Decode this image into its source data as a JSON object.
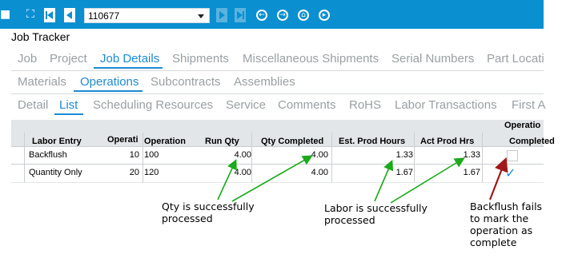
{
  "toolbar": {
    "search_icon": "binoculars-icon",
    "job_number": "110677",
    "colors": {
      "bar": "#0a8fd1",
      "accent": "#1d8ad4"
    }
  },
  "app": {
    "title": "Job Tracker"
  },
  "tabs_level1": [
    "Job",
    "Project",
    "Job Details",
    "Shipments",
    "Miscellaneous Shipments",
    "Serial Numbers",
    "Part Locati"
  ],
  "tabs_level2": [
    "Materials",
    "Operations",
    "Subcontracts",
    "Assemblies"
  ],
  "tabs_level3": [
    "Detail",
    "List",
    "Scheduling Resources",
    "Service",
    "Comments",
    "RoHS",
    "Labor Transactions",
    "First A"
  ],
  "grid": {
    "group_header": "Operatio",
    "columns": [
      "Labor Entry",
      "Operati",
      "Operation",
      "Run Qty",
      "Qty Completed",
      "Est. Prod Hours",
      "Act Prod Hrs",
      "Completed"
    ],
    "rows": [
      {
        "labor_entry": "Backflush",
        "operati": "10",
        "operation": "100",
        "run_qty": "4.00",
        "qty_completed": "4.00",
        "est_prod_hours": "1.33",
        "act_prod_hrs": "1.33",
        "completed": false
      },
      {
        "labor_entry": "Quantity Only",
        "operati": "20",
        "operation": "120",
        "run_qty": "4.00",
        "qty_completed": "4.00",
        "est_prod_hours": "1.67",
        "act_prod_hrs": "1.67",
        "completed": true
      }
    ]
  },
  "annotations": {
    "qty": [
      "Qty is successfully",
      "processed"
    ],
    "labor": [
      "Labor is successfully",
      "processed"
    ],
    "backflush": [
      "Backflush fails",
      "to mark the",
      "operation as",
      "complete"
    ],
    "colors": {
      "green": "#1aaa1a",
      "red": "#a01818"
    }
  }
}
